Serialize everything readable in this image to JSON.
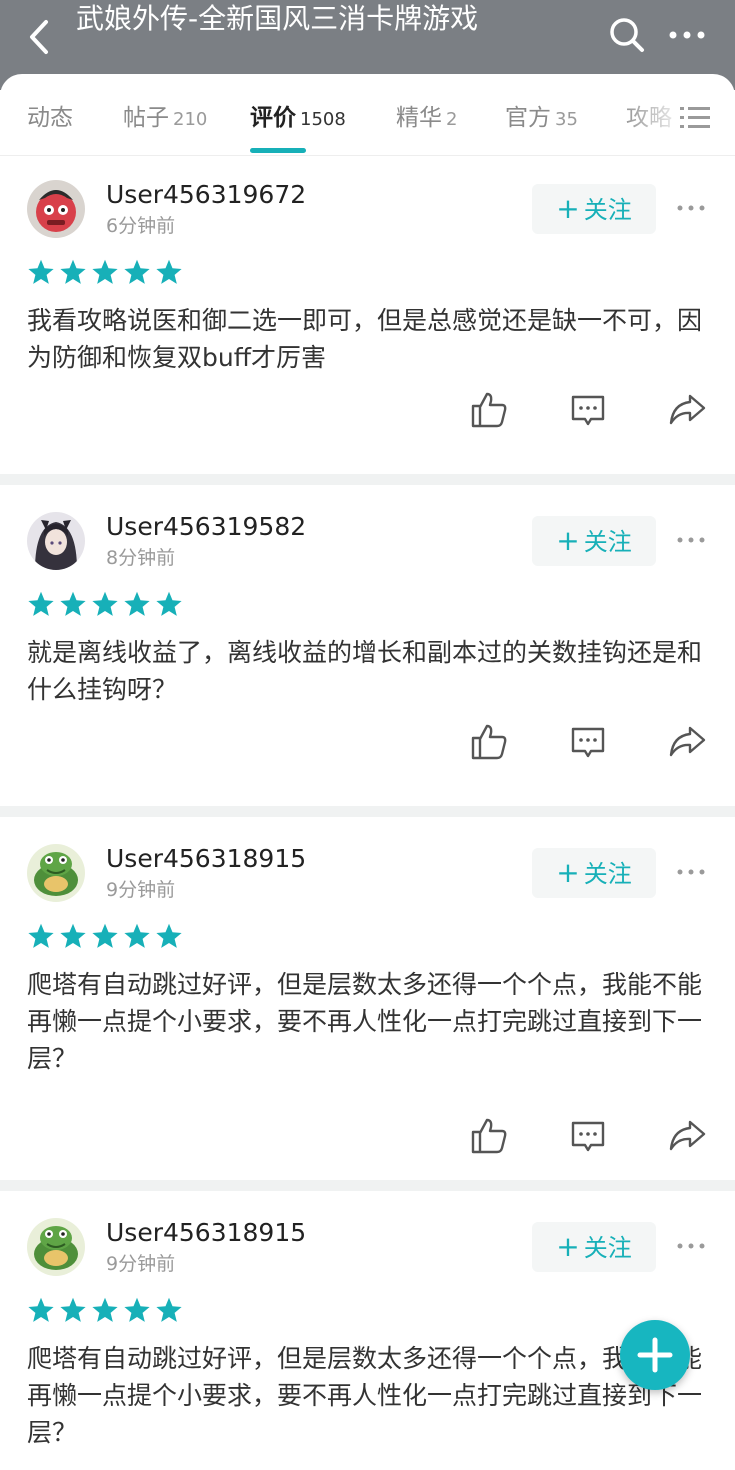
{
  "header": {
    "title": "武娘外传-全新国风三消卡牌游戏",
    "back_icon": "chevron-left-icon",
    "search_icon": "search-icon",
    "more_icon": "more-horizontal-icon",
    "bg_color": "#7b7f84"
  },
  "tabs": [
    {
      "label": "动态",
      "count": ""
    },
    {
      "label": "帖子",
      "count": "210"
    },
    {
      "label": "评价",
      "count": "1508",
      "active": true
    },
    {
      "label": "精华",
      "count": "2"
    },
    {
      "label": "官方",
      "count": "35"
    },
    {
      "label": "攻略",
      "count": ""
    }
  ],
  "tabs_menu_icon": "list-icon",
  "accent_color": "#17b0b8",
  "reviews": [
    {
      "username": "User456319672",
      "time": "6分钟前",
      "follow_label": "关注",
      "rating": 5,
      "text": "我看攻略说医和御二选一即可，但是总感觉还是缺一不可，因为防御和恢复双buff才厉害"
    },
    {
      "username": "User456319582",
      "time": "8分钟前",
      "follow_label": "关注",
      "rating": 5,
      "text": "就是离线收益了，离线收益的增长和副本过的关数挂钩还是和什么挂钩呀？"
    },
    {
      "username": "User456318915",
      "time": "9分钟前",
      "follow_label": "关注",
      "rating": 5,
      "text": "爬塔有自动跳过好评，但是层数太多还得一个个点，我能不能再懒一点提个小要求，要不再人性化一点打完跳过直接到下一层？"
    },
    {
      "username": "User456318915",
      "time": "9分钟前",
      "follow_label": "关注",
      "rating": 5,
      "text": "爬塔有自动跳过好评，但是层数太多还得一个个点，我能不能再懒一点提个小要求，要不再人性化一点打完跳过直接到下一层？"
    }
  ],
  "action_icons": [
    "thumbs-up-icon",
    "comment-icon",
    "share-icon"
  ],
  "fab_icon": "plus-icon"
}
